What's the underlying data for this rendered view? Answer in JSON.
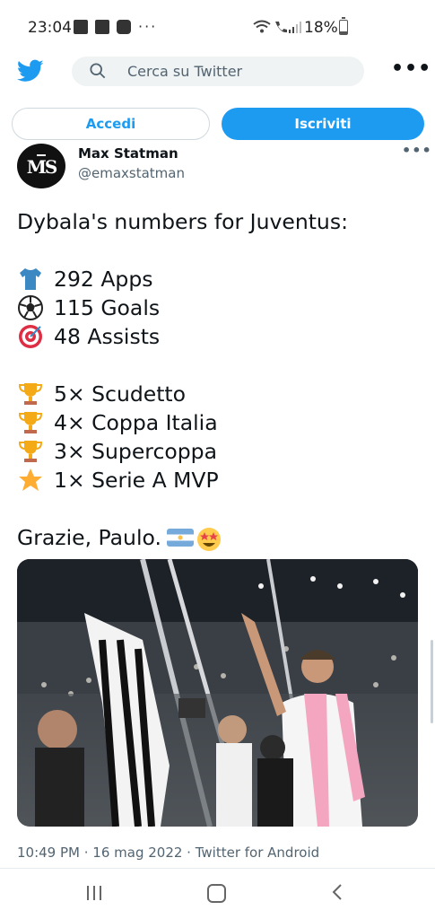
{
  "status_bar": {
    "time": "23:04",
    "battery": "18%",
    "more": "···"
  },
  "twitter": {
    "search_placeholder": "Cerca su Twitter",
    "login_label": "Accedi",
    "signup_label": "Iscriviti",
    "brand_color": "#1d9bf0"
  },
  "tweet": {
    "author_name": "Max Statman",
    "author_handle": "@emaxstatman",
    "headline": "Dybala's numbers for Juventus:",
    "stats": [
      {
        "icon": "shirt-icon",
        "text": "292 Apps"
      },
      {
        "icon": "soccer-ball-icon",
        "text": "115 Goals"
      },
      {
        "icon": "target-icon",
        "text": "48 Assists"
      }
    ],
    "trophies": [
      {
        "icon": "trophy-icon",
        "text": "5× Scudetto"
      },
      {
        "icon": "trophy-icon",
        "text": "4× Coppa Italia"
      },
      {
        "icon": "trophy-icon",
        "text": "3× Supercoppa"
      },
      {
        "icon": "star-icon",
        "text": "1× Serie A MVP"
      }
    ],
    "closing": "Grazie, Paulo.",
    "timestamp": "10:49 PM · 16 mag 2022 · Twitter for Android"
  }
}
